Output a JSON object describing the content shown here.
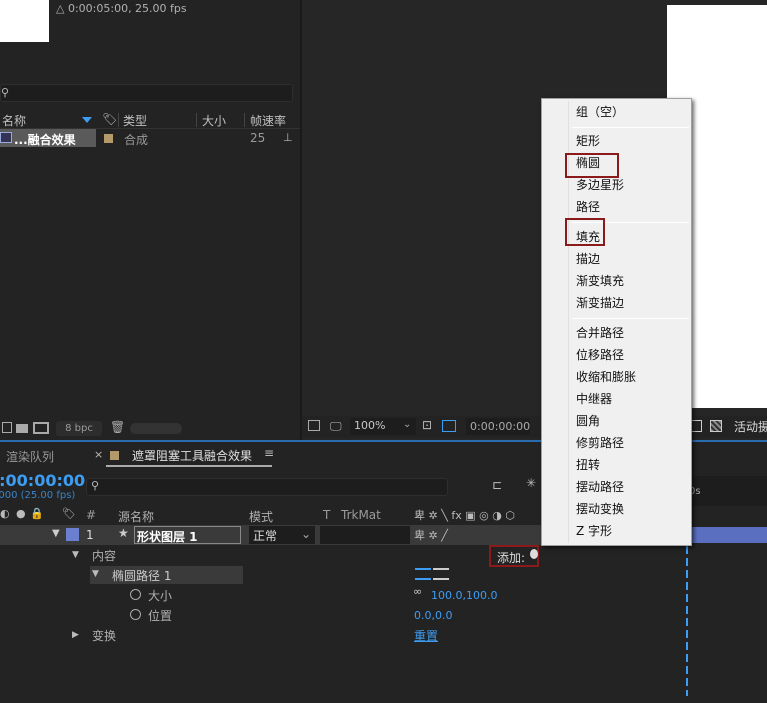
{
  "project": {
    "comp_info": "△ 0:00:05:00, 25.00 fps",
    "columns": {
      "name": "名称",
      "type": "类型",
      "size": "大小",
      "framerate": "帧速率"
    },
    "item": {
      "name": "...融合效果",
      "type": "合成",
      "framerate": "25"
    },
    "bpc": "8 bpc"
  },
  "viewer": {
    "zoom": "100%",
    "timecode": "0:00:00:00",
    "active_camera": "活动摄"
  },
  "tabs": {
    "render_queue": "渲染队列",
    "comp_tab": "遮罩阻塞工具融合效果"
  },
  "timeline": {
    "timecode": "0:00:00:00",
    "fps": "0000 (25.00 fps)",
    "col_number": "#",
    "col_source": "源名称",
    "col_mode": "模式",
    "col_t": "T",
    "col_trkmat": "TrkMat",
    "layer": {
      "number": "1",
      "name": "形状图层 1",
      "mode": "正常"
    },
    "contents": "内容",
    "add_label": "添加:",
    "ellipse_path": "椭圆路径 1",
    "size_label": "大小",
    "size_value": "100.0,100.0",
    "position_label": "位置",
    "position_value": "0.0,0.0",
    "transform": "变换",
    "reset": "重置",
    "ruler": "0s"
  },
  "menu": {
    "items": [
      "组（空）",
      "矩形",
      "椭圆",
      "多边星形",
      "路径",
      "填充",
      "描边",
      "渐变填充",
      "渐变描边",
      "合并路径",
      "位移路径",
      "收缩和膨胀",
      "中继器",
      "圆角",
      "修剪路径",
      "扭转",
      "摆动路径",
      "摆动变换",
      "Z 字形"
    ]
  },
  "colors": {
    "accent": "#3d9df3",
    "highlight_box": "#8b1a1a",
    "layer_label": "#6a7fd0"
  }
}
